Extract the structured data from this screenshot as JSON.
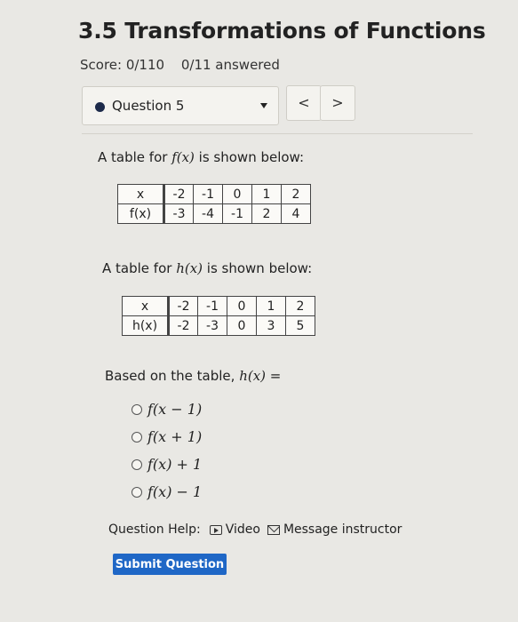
{
  "header": {
    "title": "3.5 Transformations of Functions",
    "score": "Score: 0/110",
    "answered": "0/11 answered"
  },
  "question_nav": {
    "current": "Question 5",
    "prev_symbol": "<",
    "next_symbol": ">"
  },
  "question": {
    "prompt_f_pre": "A table for ",
    "prompt_f_math": "f(x)",
    "prompt_f_post": " is shown below:",
    "table_f": {
      "row1_label": "x",
      "row2_label": "f(x)",
      "x": [
        "-2",
        "-1",
        "0",
        "1",
        "2"
      ],
      "y": [
        "-3",
        "-4",
        "-1",
        "2",
        "4"
      ]
    },
    "prompt_h_pre": "A table for ",
    "prompt_h_math": "h(x)",
    "prompt_h_post": " is shown below:",
    "table_h": {
      "row1_label": "x",
      "row2_label": "h(x)",
      "x": [
        "-2",
        "-1",
        "0",
        "1",
        "2"
      ],
      "y": [
        "-2",
        "-3",
        "0",
        "3",
        "5"
      ]
    },
    "based_pre": "Based on the table, ",
    "based_math": "h(x)",
    "based_post": " =",
    "choices": [
      "f(x − 1)",
      "f(x + 1)",
      "f(x) + 1",
      "f(x) − 1"
    ]
  },
  "help": {
    "label": "Question Help:",
    "video": "Video",
    "message": "Message instructor"
  },
  "submit_label": "Submit Question"
}
